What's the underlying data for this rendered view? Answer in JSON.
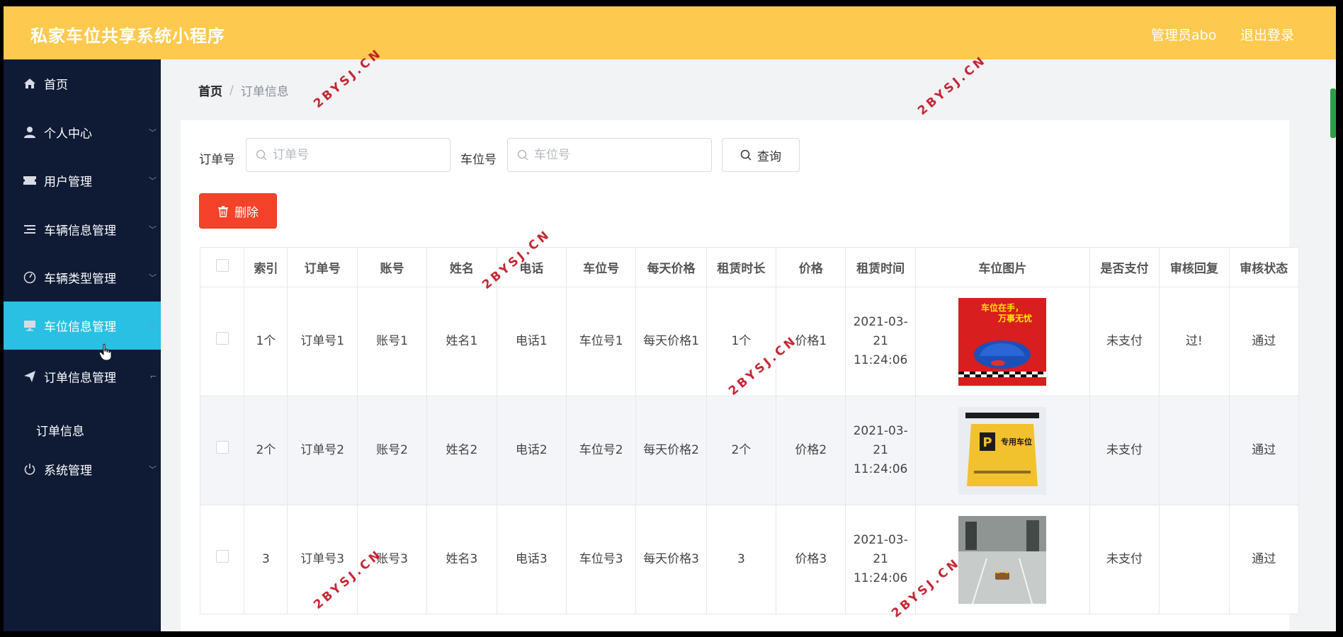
{
  "app": {
    "title": "私家车位共享系统小程序",
    "user_label": "管理员abo",
    "logout_label": "退出登录"
  },
  "sidebar": {
    "items": [
      {
        "label": "首页",
        "icon": "home-icon"
      },
      {
        "label": "个人中心",
        "icon": "user-icon"
      },
      {
        "label": "用户管理",
        "icon": "ticket-icon"
      },
      {
        "label": "车辆信息管理",
        "icon": "list-icon"
      },
      {
        "label": "车辆类型管理",
        "icon": "gauge-icon"
      },
      {
        "label": "车位信息管理",
        "icon": "monitor-icon",
        "active": true
      },
      {
        "label": "订单信息管理",
        "icon": "send-icon"
      },
      {
        "label": "订单信息",
        "sub": true
      },
      {
        "label": "系统管理",
        "icon": "power-icon"
      }
    ]
  },
  "breadcrumb": {
    "home": "首页",
    "separator": "/",
    "current": "订单信息"
  },
  "search": {
    "order_label": "订单号",
    "order_placeholder": "订单号",
    "spot_label": "车位号",
    "spot_placeholder": "车位号",
    "query_label": "查询"
  },
  "actions": {
    "delete_label": "删除"
  },
  "table": {
    "headers": [
      "索引",
      "订单号",
      "账号",
      "姓名",
      "电话",
      "车位号",
      "每天价格",
      "租赁时长",
      "价格",
      "租赁时间",
      "车位图片",
      "是否支付",
      "审核回复",
      "审核状态"
    ],
    "rows": [
      {
        "index": "1个",
        "order": "订单号1",
        "account": "账号1",
        "name": "姓名1",
        "phone": "电话1",
        "spot": "车位号1",
        "daily": "每天价格1",
        "duration": "1个",
        "price": "价格1",
        "time": "2021-03-21 11:24:06",
        "image": "parking-ad-image",
        "image_text_line1": "车位在手，",
        "image_text_line2": "万事无忧",
        "paid": "未支付",
        "reply": "过!",
        "status": "通过"
      },
      {
        "index": "2个",
        "order": "订单号2",
        "account": "账号2",
        "name": "姓名2",
        "phone": "电话2",
        "spot": "车位号2",
        "daily": "每天价格2",
        "duration": "2个",
        "price": "价格2",
        "time": "2021-03-21 11:24:06",
        "image": "parking-sign-image",
        "image_text_line1": "专用车位",
        "paid": "未支付",
        "reply": "",
        "status": "通过"
      },
      {
        "index": "3",
        "order": "订单号3",
        "account": "账号3",
        "name": "姓名3",
        "phone": "电话3",
        "spot": "车位号3",
        "daily": "每天价格3",
        "duration": "3",
        "price": "价格3",
        "time": "2021-03-21 11:24:06",
        "image": "garage-photo-image",
        "paid": "未支付",
        "reply": "",
        "status": "通过"
      }
    ]
  },
  "watermark": "2BYSJ.CN",
  "colors": {
    "header": "#fdc94f",
    "sidebar": "#0f1a35",
    "active": "#29c0e4",
    "danger": "#f5422a"
  }
}
